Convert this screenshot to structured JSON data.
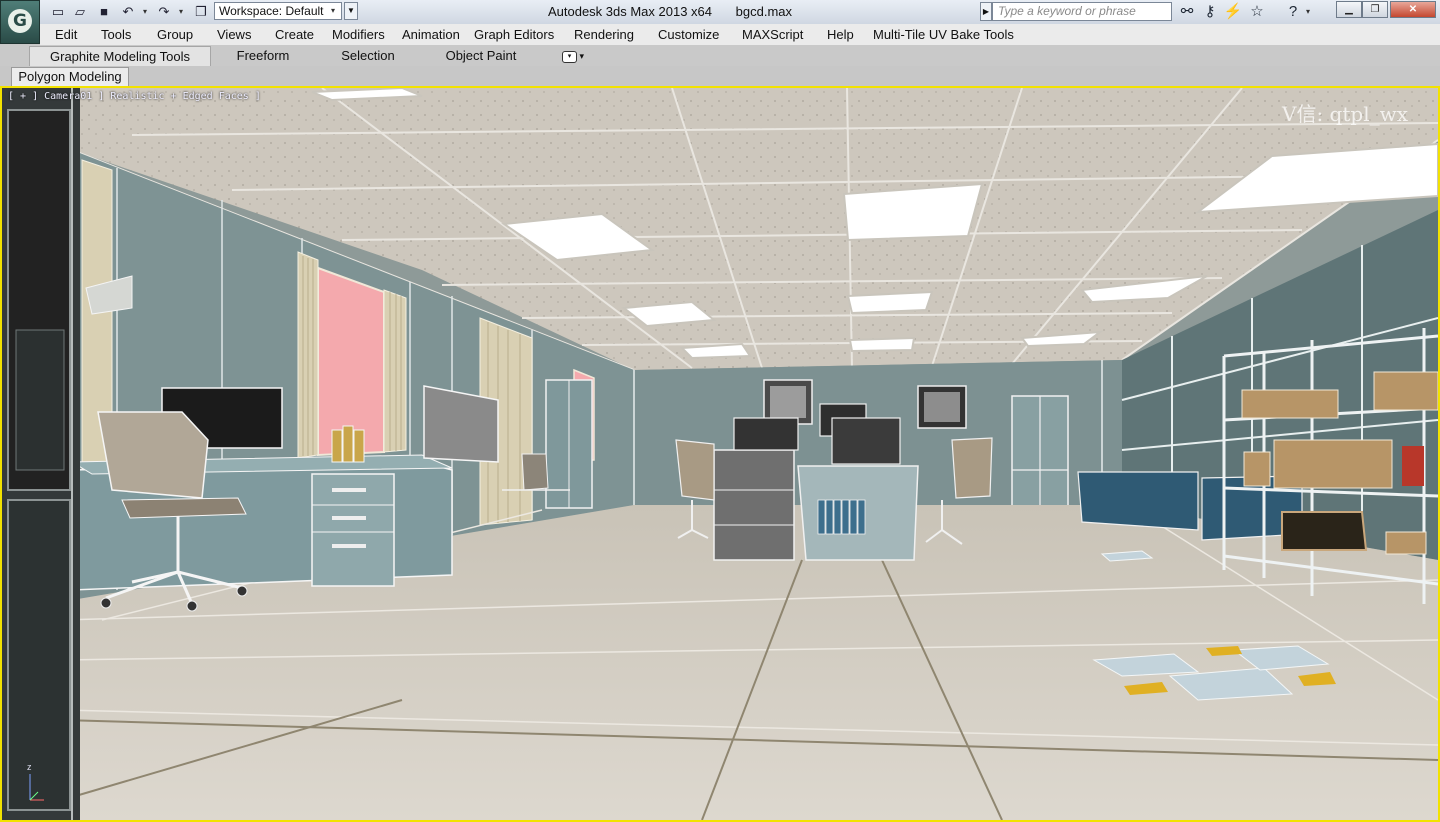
{
  "app": {
    "logo_letter": "G",
    "window_title": "Autodesk 3ds Max  2013 x64",
    "file_name": "bgcd.max",
    "workspace": "Workspace: Default",
    "search_placeholder": "Type a keyword or phrase"
  },
  "menu": [
    "Edit",
    "Tools",
    "Group",
    "Views",
    "Create",
    "Modifiers",
    "Animation",
    "Graph Editors",
    "Rendering",
    "Customize",
    "MAXScript",
    "Help",
    "Multi-Tile UV Bake Tools"
  ],
  "ribbon": {
    "tabs": [
      "Graphite Modeling Tools",
      "Freeform",
      "Selection",
      "Object Paint"
    ],
    "active_tab": "Graphite Modeling Tools",
    "panel": "Polygon Modeling"
  },
  "viewport": {
    "label": "[ + ] Camera01 ] Realistic + Edged Faces ]",
    "watermark": "V信: qtpl_wx",
    "axis_label": "z",
    "border_color": "#f2e200"
  },
  "icons": {
    "new": "new-file-icon",
    "open": "open-file-icon",
    "save": "save-icon",
    "undo": "undo-icon",
    "redo": "redo-icon",
    "project": "project-folder-icon",
    "binoculars": "binoculars-icon",
    "key": "subscription-key-icon",
    "communication": "communication-center-icon",
    "favorites": "star-icon",
    "help": "help-icon",
    "minimize": "minimize-icon",
    "restore": "restore-icon",
    "close": "close-icon"
  }
}
